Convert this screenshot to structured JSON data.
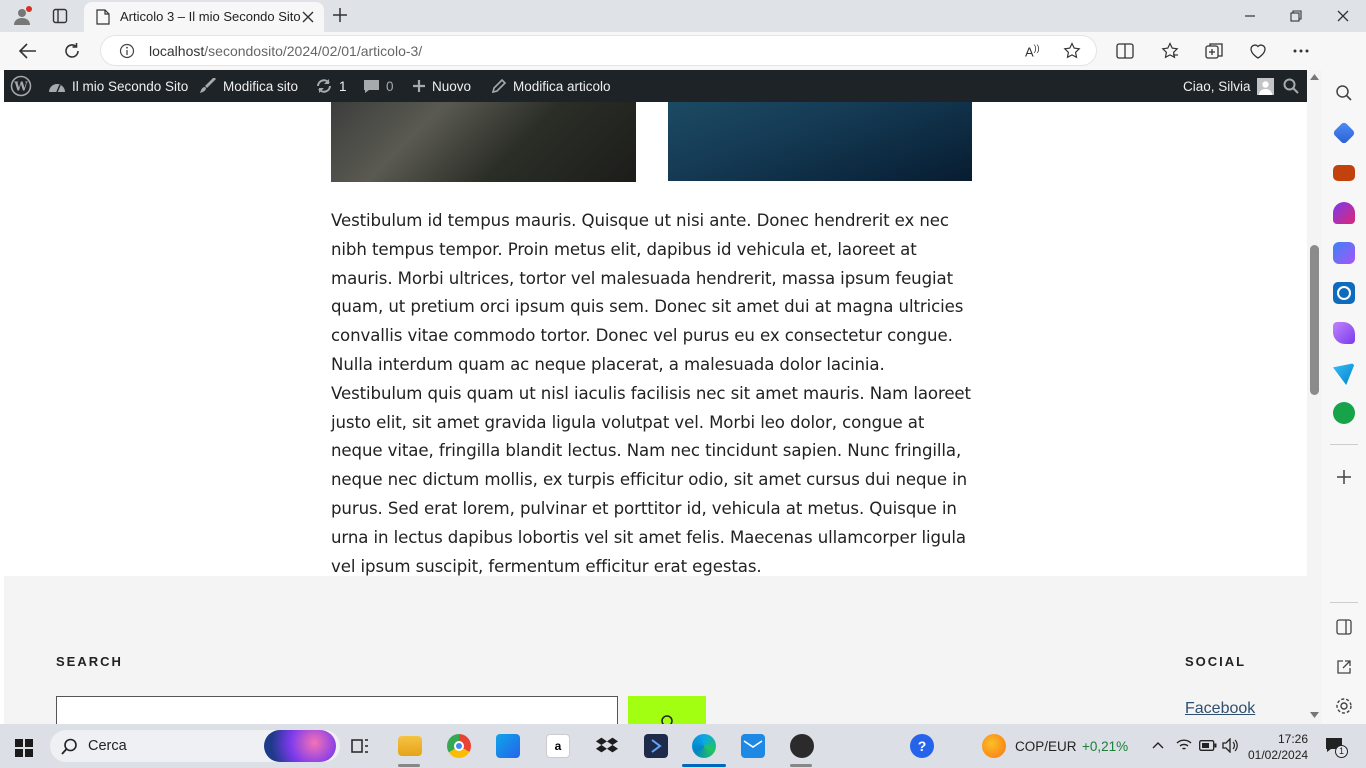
{
  "browser": {
    "tab_title": "Articolo 3 – Il mio Secondo Sito",
    "url_host": "localhost",
    "url_path": "/secondosito/2024/02/01/articolo-3/"
  },
  "wp_admin_bar": {
    "site_name": "Il mio Secondo Sito",
    "customize": "Modifica sito",
    "updates_count": "1",
    "comments_count": "0",
    "new_label": "Nuovo",
    "edit_post": "Modifica articolo",
    "greeting": "Ciao, Silvia"
  },
  "article": {
    "paragraph": "Vestibulum id tempus mauris. Quisque ut nisi ante. Donec hendrerit ex nec nibh tempus tempor. Proin metus elit, dapibus id vehicula et, laoreet at mauris. Morbi ultrices, tortor vel malesuada hendrerit, massa ipsum feugiat quam, ut pretium orci ipsum quis sem. Donec sit amet dui at magna ultricies convallis vitae commodo tortor. Donec vel purus eu ex consectetur congue. Nulla interdum quam ac neque placerat, a malesuada dolor lacinia. Vestibulum quis quam ut nisl iaculis facilisis nec sit amet mauris. Nam laoreet justo elit, sit amet gravida ligula volutpat vel. Morbi leo dolor, congue at neque vitae, fringilla blandit lectus. Nam nec tincidunt sapien. Nunc fringilla, neque nec dictum mollis, ex turpis efficitur odio, sit amet cursus dui neque in purus. Sed erat lorem, pulvinar et porttitor id, vehicula at metus. Quisque in urna in lectus dapibus lobortis vel sit amet felis. Maecenas ullamcorper ligula vel ipsum suscipit, fermentum efficitur erat egestas."
  },
  "footer": {
    "search_title": "SEARCH",
    "social_title": "SOCIAL",
    "facebook_link": "Facebook",
    "search_button_color": "#a3ff12"
  },
  "taskbar": {
    "search_label": "Cerca",
    "currency_pair": "COP/EUR",
    "currency_change": "+0,21%",
    "time": "17:26",
    "date": "01/02/2024",
    "notification_count": "1"
  },
  "colors": {
    "admin_bar": "#1d2327",
    "accent_green": "#a3ff12",
    "positive": "#1a7f37"
  }
}
